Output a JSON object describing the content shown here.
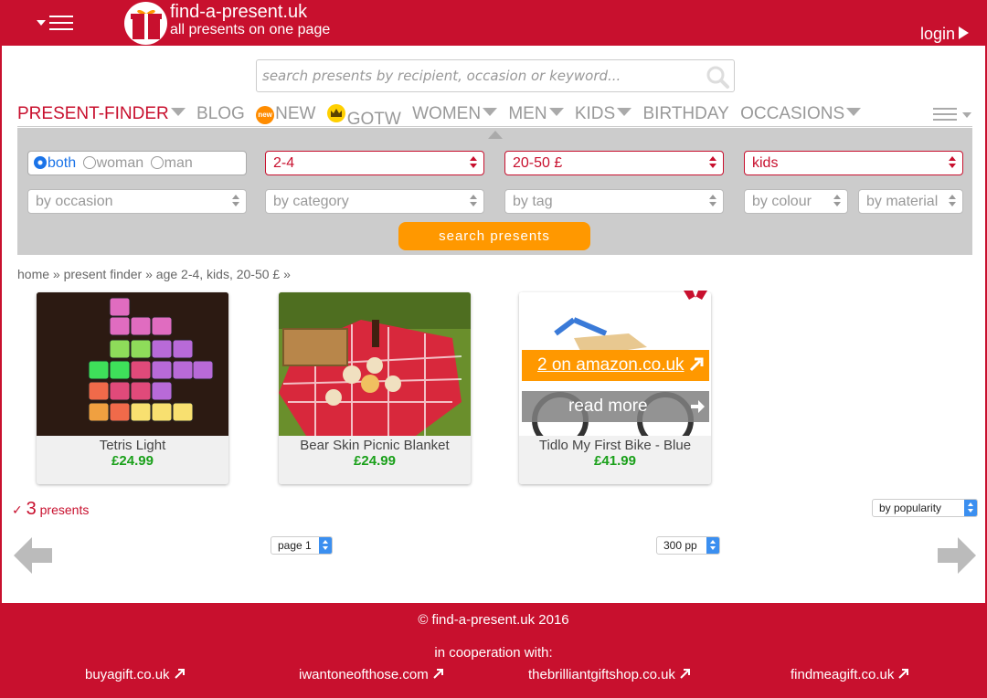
{
  "header": {
    "site_name": "find-a-present.uk",
    "tagline": "all presents on one page",
    "login_label": "login"
  },
  "search": {
    "placeholder": "search presents by recipient, occasion or keyword..."
  },
  "nav": {
    "items": [
      {
        "label": "PRESENT-FINDER",
        "active": true
      },
      {
        "label": "BLOG"
      },
      {
        "label": "NEW",
        "badge": "new"
      },
      {
        "label": "GOTW",
        "icon": "crown-icon"
      },
      {
        "label": "WOMEN"
      },
      {
        "label": "MEN"
      },
      {
        "label": "KIDS"
      },
      {
        "label": "BIRTHDAY"
      },
      {
        "label": "OCCASIONS"
      }
    ]
  },
  "filters": {
    "gender": {
      "options": [
        "both",
        "woman",
        "man"
      ],
      "selected": "both"
    },
    "age": "2-4",
    "price": "20-50 £",
    "recipient": "kids",
    "occasion": "by occasion",
    "category": "by category",
    "tag": "by tag",
    "colour": "by colour",
    "material": "by material",
    "search_button": "search presents"
  },
  "breadcrumb": {
    "home": "home",
    "finder": "present finder",
    "current": "age 2-4, kids, 20-50 £"
  },
  "products": [
    {
      "title": "Tetris Light",
      "price": "£24.99"
    },
    {
      "title": "Bear Skin Picnic Blanket",
      "price": "£24.99"
    },
    {
      "title": "Tidlo My First Bike - Blue",
      "price": "£41.99",
      "amazon_label": "2 on amazon.co.uk",
      "read_more": "read more"
    }
  ],
  "results": {
    "check": "✓",
    "count": "3",
    "count_label": "presents",
    "sort": "by popularity",
    "page": "page 1",
    "per_page": "300 pp"
  },
  "footer": {
    "copyright": "© find-a-present.uk 2016",
    "cooperation": "in cooperation with:",
    "links": [
      "buyagift.co.uk",
      "iwantoneofthose.com",
      "thebrilliantgiftshop.co.uk",
      "findmeagift.co.uk"
    ]
  },
  "colors": {
    "brand_red": "#c8102e",
    "accent_orange": "#ff9800",
    "price_green": "#1aa01a",
    "panel_grey": "#cccccc"
  }
}
